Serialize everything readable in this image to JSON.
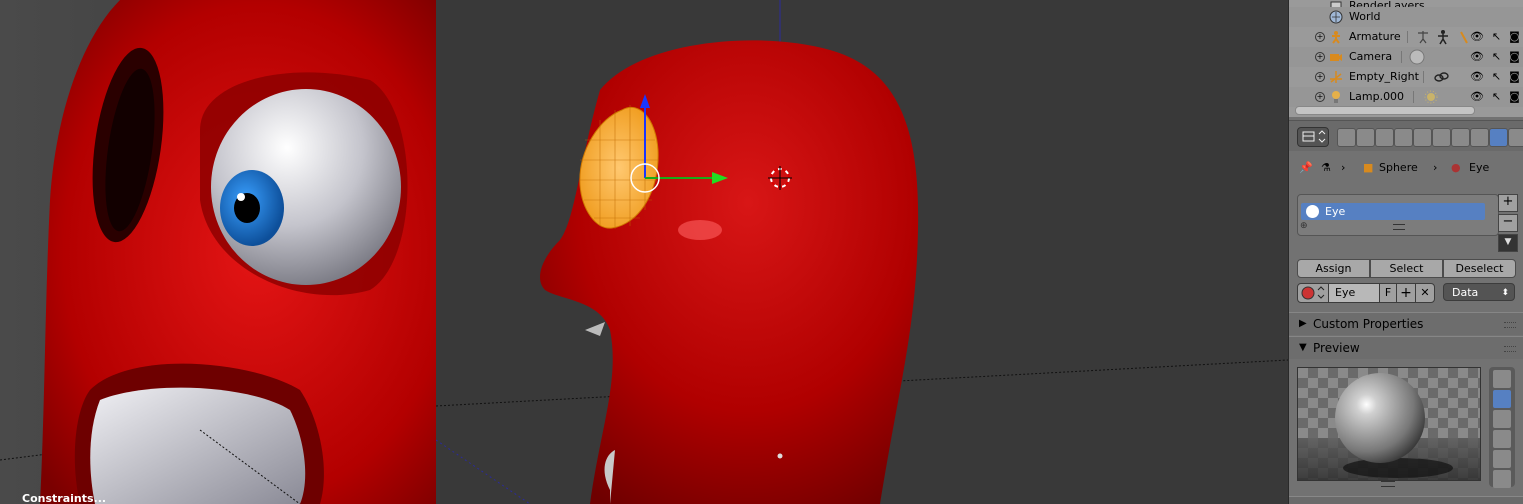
{
  "outliner": {
    "rows": [
      {
        "label": "RenderLayers",
        "icon": "renderlayers-icon"
      },
      {
        "label": "World",
        "icon": "world-icon"
      },
      {
        "label": "Armature",
        "icon": "armature-icon"
      },
      {
        "label": "Camera",
        "icon": "camera-icon"
      },
      {
        "label": "Empty_Right",
        "icon": "empty-icon"
      },
      {
        "label": "Lamp.000",
        "icon": "lamp-icon"
      }
    ]
  },
  "properties": {
    "breadcrumb": {
      "object": "Sphere",
      "material": "Eye"
    },
    "material_slots": [
      "Eye"
    ],
    "buttons": {
      "assign": "Assign",
      "select": "Select",
      "deselect": "Deselect"
    },
    "material_field": {
      "name": "Eye",
      "fake_user": "F",
      "link": "Data"
    },
    "sections": {
      "custom_properties": "Custom Properties",
      "preview": "Preview"
    }
  },
  "viewport": {
    "bottom_text": "Constraints..."
  },
  "colors": {
    "accent": "#5680c2",
    "body_red": "#b10000",
    "selection_orange": "#f5a623"
  }
}
